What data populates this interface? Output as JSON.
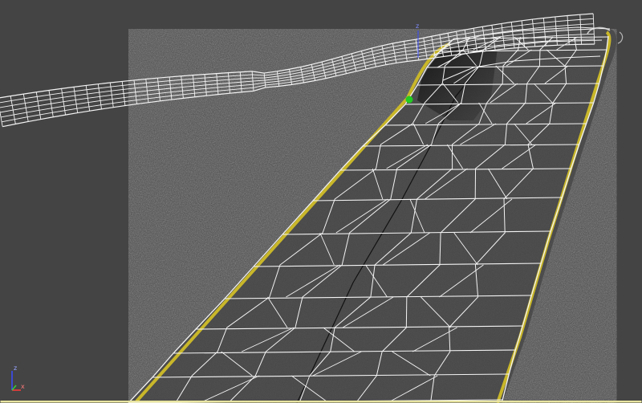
{
  "viewport": {
    "background": "#444444",
    "selection_border_color": "#e8e4a0"
  },
  "road": {
    "surface_color": "#4a4a4a",
    "wire_color": "#f4f4f4",
    "edge_line_color": "#c9b72a",
    "center_line_color": "#111111",
    "shadow_color": "#1c1c1c"
  },
  "pivot_point": {
    "color": "#22cc22"
  },
  "axis_gizmo": {
    "z_label": "z",
    "x_label": "x",
    "z_color": "#3a4cff",
    "x_color": "#ff3a3a",
    "y_color": "#36d036"
  },
  "target_gizmo": {
    "z_label": "z"
  }
}
